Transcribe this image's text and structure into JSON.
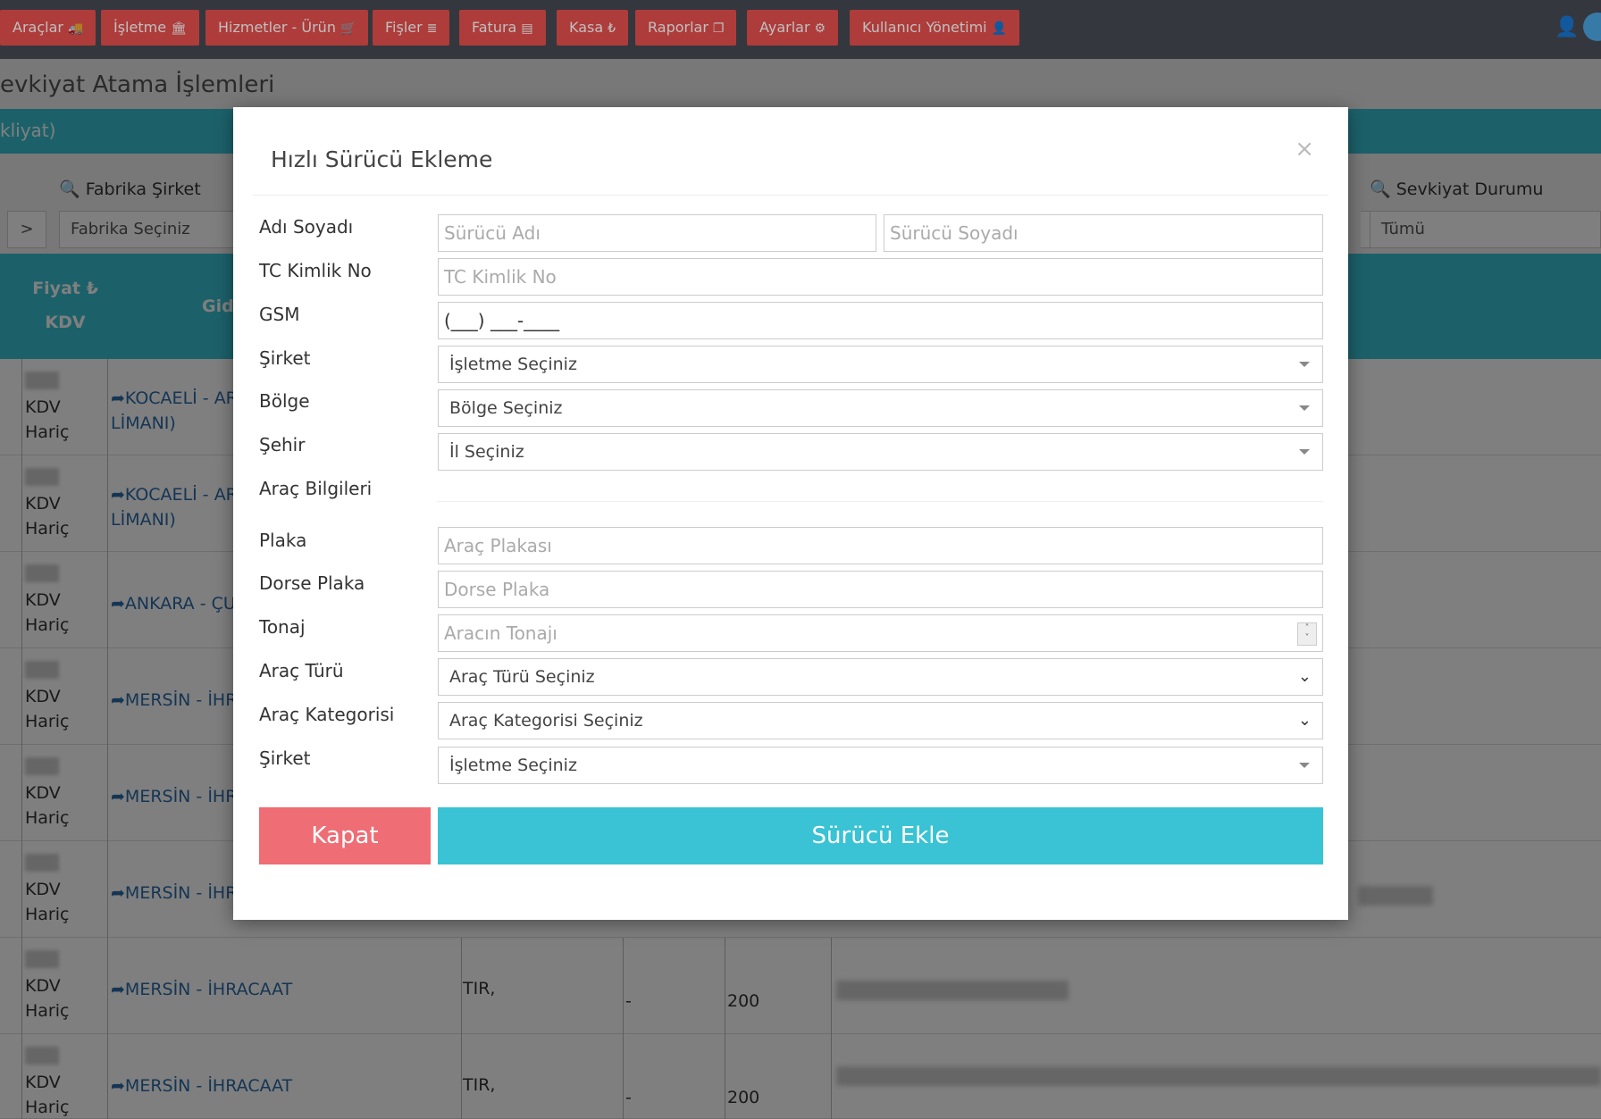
{
  "nav": {
    "items": [
      {
        "label": "Araçlar",
        "icon": "truck-icon",
        "glyph": "🚚"
      },
      {
        "label": "İşletme",
        "icon": "bank-icon",
        "glyph": "🏛"
      },
      {
        "label": "Hizmetler - Ürün",
        "icon": "cart-icon",
        "glyph": "🛒"
      },
      {
        "label": "Fişler",
        "icon": "database-icon",
        "glyph": "≣"
      },
      {
        "label": "Fatura",
        "icon": "invoice-icon",
        "glyph": "▤"
      },
      {
        "label": "Kasa",
        "icon": "lira-icon",
        "glyph": "₺"
      },
      {
        "label": "Raporlar",
        "icon": "files-icon",
        "glyph": "❐"
      },
      {
        "label": "Ayarlar",
        "icon": "gears-icon",
        "glyph": "⚙"
      },
      {
        "label": "Kullanıcı Yönetimi",
        "icon": "user-icon",
        "glyph": "👤"
      }
    ]
  },
  "page": {
    "title": "evkiyat Atama İşlemleri",
    "bar_text": "kliyat)",
    "filters": {
      "factory_label": "Fabrika Şirket",
      "factory_value": "Fabrika Seçiniz",
      "status_label": "Sevkiyat Durumu",
      "status_value": "Tümü",
      "nav_arrow": ">"
    },
    "table": {
      "col_price": "Fiyat ₺",
      "col_kdv": "KDV",
      "col_dest": "Gid",
      "rows": [
        {
          "kdv": "KDV",
          "kdv2": "Hariç",
          "route": "➦KOCAELİ - AR",
          "route2": "LİMANI)"
        },
        {
          "kdv": "KDV",
          "kdv2": "Hariç",
          "route": "➦KOCAELİ - AR",
          "route2": "LİMANI)"
        },
        {
          "kdv": "KDV",
          "kdv2": "Hariç",
          "route": "➦ANKARA - ÇU",
          "route2": ""
        },
        {
          "kdv": "KDV",
          "kdv2": "Hariç",
          "route": "➦MERSİN - İHR",
          "route2": ""
        },
        {
          "kdv": "KDV",
          "kdv2": "Hariç",
          "route": "➦MERSİN - İHR",
          "route2": ""
        },
        {
          "kdv": "KDV",
          "kdv2": "Hariç",
          "route": "➦MERSİN - İHR",
          "route2": ""
        },
        {
          "kdv": "KDV",
          "kdv2": "Hariç",
          "route": "➦MERSİN - İHRACAAT",
          "route2": "",
          "type": "TIR,",
          "dash": "-",
          "amount": "200"
        },
        {
          "kdv": "KDV",
          "kdv2": "Hariç",
          "route": "➦MERSİN - İHRACAAT",
          "route2": "",
          "type": "TIR,",
          "dash": "-",
          "amount": "200"
        }
      ]
    }
  },
  "modal": {
    "title": "Hızlı Sürücü Ekleme",
    "close_glyph": "×",
    "fields": {
      "name_label": "Adı Soyadı",
      "first_name_ph": "Sürücü Adı",
      "last_name_ph": "Sürücü Soyadı",
      "tc_label": "TC Kimlik No",
      "tc_ph": "TC Kimlik No",
      "gsm_label": "GSM",
      "gsm_value": "(___) ___-____",
      "company_label": "Şirket",
      "company_value": "İşletme Seçiniz",
      "region_label": "Bölge",
      "region_value": "Bölge Seçiniz",
      "city_label": "Şehir",
      "city_value": "İl Seçiniz",
      "vehicle_section": "Araç Bilgileri",
      "plate_label": "Plaka",
      "plate_ph": "Araç Plakası",
      "trailer_label": "Dorse Plaka",
      "trailer_ph": "Dorse Plaka",
      "tonnage_label": "Tonaj",
      "tonnage_ph": "Aracın Tonajı",
      "vtype_label": "Araç Türü",
      "vtype_value": "Araç Türü Seçiniz",
      "vcat_label": "Araç Kategorisi",
      "vcat_value": "Araç Kategorisi Seçiniz",
      "company2_label": "Şirket",
      "company2_value": "İşletme Seçiniz"
    },
    "buttons": {
      "close": "Kapat",
      "submit": "Sürücü Ekle"
    }
  }
}
